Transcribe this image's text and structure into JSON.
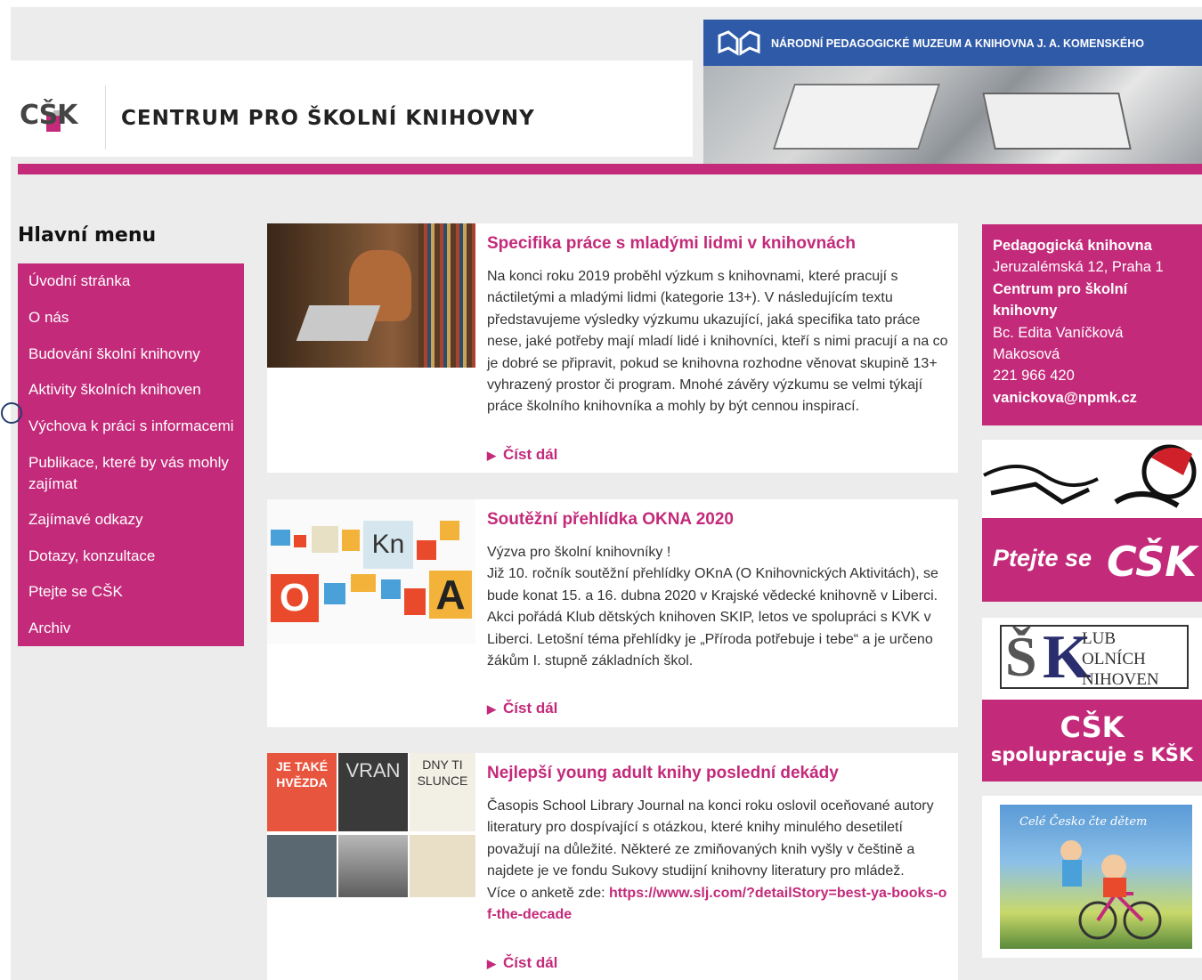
{
  "header": {
    "logo_text": "CŠK",
    "site_title": "CENTRUM PRO ŠKOLNÍ KNIHOVNY",
    "museum_name": "NÁRODNÍ PEDAGOGICKÉ MUZEUM A KNIHOVNA J. A. KOMENSKÉHO",
    "accent_color": "#c32a7a",
    "museum_bar_color": "#2e5aa8"
  },
  "menu": {
    "heading": "Hlavní menu",
    "items": [
      "Úvodní stránka",
      "O nás",
      "Budování školní knihovny",
      "Aktivity školních knihoven",
      "Výchova k práci s informacemi",
      "Publikace, které by vás mohly zajímat",
      "Zajímavé odkazy",
      "Dotazy, konzultace",
      "Ptejte se CŠK",
      "Archiv"
    ]
  },
  "articles": [
    {
      "title": "Specifika práce s mladými lidmi v knihovnách",
      "body": "Na konci roku 2019 proběhl výzkum s knihovnami, které pracují s náctiletými a mladými lidmi (kategorie 13+). V následujícím textu představujeme výsledky výzkumu ukazující, jaká specifika tato práce nese, jaké potřeby mají mladí lidé i knihovníci, kteří s nimi pracují a na co je dobré se připravit, pokud se knihovna rozhodne věnovat skupině 13+ vyhrazený prostor či program. Mnohé závěry výzkumu se velmi týkají práce školního knihovníka a mohly by být cennou inspirací.",
      "read_more": "Číst dál"
    },
    {
      "title": "Soutěžní přehlídka OKNA 2020",
      "body_line1": "Výzva pro školní knihovníky !",
      "body": "Již 10. ročník soutěžní přehlídky OKnA (O Knihovnických Aktivitách), se bude konat 15. a 16. dubna 2020 v Krajské vědecké knihovně v Liberci. Akci pořádá Klub dětských knihoven SKIP, letos ve spolupráci s KVK v Liberci. Letošní téma přehlídky je „Příroda potřebuje i tebe“ a je určeno žákům I. stupně základních škol.",
      "read_more": "Číst dál",
      "thumb_letters": [
        "Kn",
        "O",
        "A"
      ]
    },
    {
      "title": "Nejlepší young adult knihy poslední dekády",
      "body": "Časopis School Library Journal na konci roku oslovil oceňované autory literatury pro dospívající s otázkou, které knihy minulého desetiletí považují na důležité. Některé ze zmiňovaných knih vyšly v češtině a najdete je ve fondu Sukovy studijní knihovny literatury pro mládež.",
      "body_link_prefix": "Více o anketě zde: ",
      "body_link": "https://www.slj.com/?detailStory=best-ya-books-of-the-decade",
      "read_more": "Číst dál",
      "thumb_covers": [
        "JE TAKÉ HVĚZDA",
        "VRAN",
        "DNY TI SLUNCE"
      ]
    }
  ],
  "sidebar": {
    "contact": {
      "org": "Pedagogická knihovna",
      "address": "Jeruzalémská 12,  Praha 1",
      "dept": "Centrum pro školní knihovny",
      "person": "Bc. Edita Vaníčková Makosová",
      "phone": "221 966 420",
      "email": "vanickova@npmk.cz"
    },
    "ptejte_banner": {
      "text1": "Ptejte se",
      "text2": "CŠK"
    },
    "ksk_logo": {
      "letters": "ŠK",
      "lines": [
        "LUB",
        "OLNÍCH",
        "NIHOVEN"
      ]
    },
    "csk_spol": {
      "line1": "CŠK",
      "line2": "spolupracuje s KŠK"
    },
    "cele_cesko": {
      "caption": "Celé Česko čte dětem"
    }
  }
}
